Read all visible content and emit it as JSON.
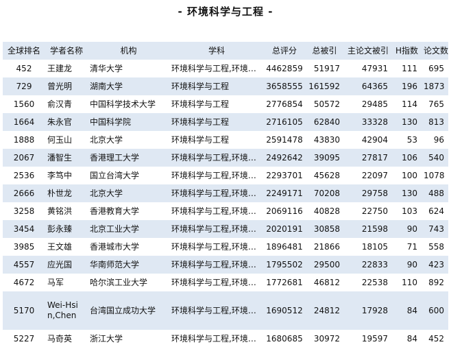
{
  "page": {
    "title": "- 环境科学与工程 -"
  },
  "table": {
    "headers": [
      "全球排名",
      "学者名称",
      "机构",
      "学科",
      "总评分",
      "总被引",
      "主论文被引",
      "H指数",
      "论文数"
    ],
    "rows": [
      [
        "452",
        "王建龙",
        "清华大学",
        "环境科学与工程,环境…",
        "4462859",
        "51917",
        "47931",
        "111",
        "695"
      ],
      [
        "729",
        "曾光明",
        "湖南大学",
        "环境科学与工程",
        "3658555",
        "161592",
        "64365",
        "196",
        "1873"
      ],
      [
        "1560",
        "俞汉青",
        "中国科学技术大学",
        "环境科学与工程",
        "2776854",
        "50572",
        "29485",
        "114",
        "765"
      ],
      [
        "1664",
        "朱永官",
        "中国科学院",
        "环境科学与工程",
        "2716105",
        "62840",
        "33328",
        "130",
        "813"
      ],
      [
        "1888",
        "何玉山",
        "北京大学",
        "环境科学与工程",
        "2591478",
        "43830",
        "42904",
        "53",
        "96"
      ],
      [
        "2067",
        "潘智生",
        "香港理工大学",
        "环境科学与工程,环境…",
        "2492642",
        "39095",
        "27817",
        "106",
        "540"
      ],
      [
        "2536",
        "李笃中",
        "国立台湾大学",
        "环境科学与工程,环境…",
        "2293701",
        "45628",
        "22097",
        "100",
        "1078"
      ],
      [
        "2666",
        "朴世龙",
        "北京大学",
        "环境科学与工程,环境…",
        "2249171",
        "70208",
        "29758",
        "130",
        "488"
      ],
      [
        "3258",
        "黄铭洪",
        "香港教育大学",
        "环境科学与工程,环境…",
        "2069116",
        "40828",
        "22750",
        "103",
        "624"
      ],
      [
        "3454",
        "彭永臻",
        "北京工业大学",
        "环境科学与工程,环境…",
        "2020191",
        "30858",
        "21598",
        "90",
        "743"
      ],
      [
        "3985",
        "王文雄",
        "香港城市大学",
        "环境科学与工程,环境…",
        "1896481",
        "21866",
        "18105",
        "71",
        "558"
      ],
      [
        "4557",
        "应光国",
        "华南师范大学",
        "环境科学与工程,环境…",
        "1795502",
        "29500",
        "22833",
        "90",
        "423"
      ],
      [
        "4672",
        "马军",
        "哈尔滨工业大学",
        "环境科学与工程,环境…",
        "1772681",
        "46812",
        "22538",
        "110",
        "892"
      ],
      [
        "5170",
        "Wei-Hsin,Chen",
        "台湾国立成功大学",
        "环境科学与工程,环境…",
        "1690512",
        "24812",
        "17928",
        "84",
        "600"
      ],
      [
        "5227",
        "马奇英",
        "浙江大学",
        "环境科学与工程,环境…",
        "1680685",
        "30972",
        "19597",
        "84",
        "452"
      ]
    ]
  },
  "colors": {
    "header_bg": "#dfe8f3",
    "stripe_bg": "#dfe8f3",
    "text": "#111111"
  }
}
